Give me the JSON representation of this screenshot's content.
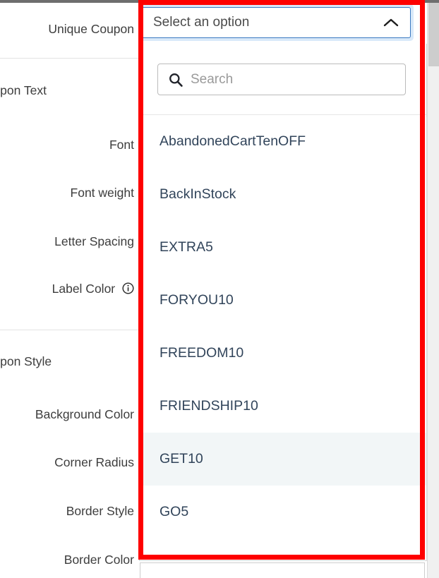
{
  "window": {
    "accent_blue": "#3878c1",
    "focus_ring": "#d9e9f9",
    "annotation_color": "#fe0000",
    "highlight_row_color": "#f2f6f7"
  },
  "settings_panel": {
    "rows": [
      {
        "label": "Unique Coupon",
        "type": "field-label"
      },
      {
        "label": "Coupon Text",
        "type": "section-header"
      },
      {
        "label": "Font",
        "type": "field-label"
      },
      {
        "label": "Font weight",
        "type": "field-label"
      },
      {
        "label": "Letter Spacing",
        "type": "field-label"
      },
      {
        "label": "Label Color",
        "type": "field-label",
        "info": true
      },
      {
        "label": "Coupon Style",
        "type": "section-header"
      },
      {
        "label": "Background Color",
        "type": "field-label"
      },
      {
        "label": "Corner Radius",
        "type": "field-label"
      },
      {
        "label": "Border Style",
        "type": "field-label"
      },
      {
        "label": "Border Color",
        "type": "field-label"
      }
    ]
  },
  "select": {
    "name": "unique-coupon-select",
    "value": "Select an option",
    "state": "open",
    "chevron": "chevron-up-icon"
  },
  "dropdown": {
    "search": {
      "icon": "search-icon",
      "placeholder": "Search",
      "value": ""
    },
    "options": [
      {
        "label": "AbandonedCartTenOFF",
        "highlighted": false
      },
      {
        "label": "BackInStock",
        "highlighted": false
      },
      {
        "label": "EXTRA5",
        "highlighted": false
      },
      {
        "label": "FORYOU10",
        "highlighted": false
      },
      {
        "label": "FREEDOM10",
        "highlighted": false
      },
      {
        "label": "FRIENDSHIP10",
        "highlighted": false
      },
      {
        "label": "GET10",
        "highlighted": true
      },
      {
        "label": "GO5",
        "highlighted": false
      }
    ],
    "scrollbar": {
      "up_arrow": "chevron-up-icon",
      "down_arrow": "chevron-down-icon"
    }
  }
}
